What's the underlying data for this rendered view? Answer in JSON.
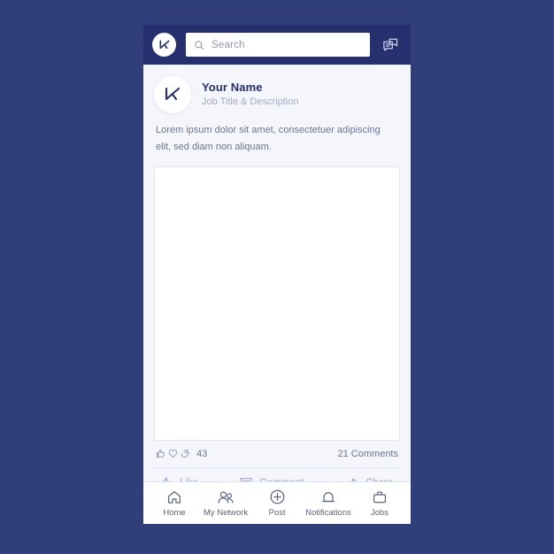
{
  "colors": {
    "page_background": "#303e79",
    "header_background": "#26306e",
    "card_background": "#f4f6fc",
    "brand_navy": "#26306e",
    "muted_text": "#6e7493",
    "placeholder_text": "#9296b4",
    "action_purple": "#9ea2d6",
    "subtitle_gray": "#a6aac6"
  },
  "header": {
    "logo_icon": "brand-logo-icon",
    "search": {
      "icon": "search-icon",
      "placeholder": "Search",
      "value": ""
    },
    "messages_icon": "messages-icon"
  },
  "post": {
    "avatar_icon": "brand-avatar-icon",
    "author_name": "Your Name",
    "author_title": "Job Title & Description",
    "body_text": "Lorem ipsum dolor sit amet, consectetuer adipiscing elit, sed diam non aliquam.",
    "image_placeholder_name": "post-image-placeholder",
    "stats": {
      "reaction_icons": [
        "thumbs-up-icon",
        "heart-icon",
        "clap-icon"
      ],
      "reaction_count": "43",
      "comments_text": "21 Comments"
    },
    "actions": [
      {
        "label": "Like",
        "icon": "thumbs-up-icon"
      },
      {
        "label": "Comment",
        "icon": "comment-icon"
      },
      {
        "label": "Share",
        "icon": "share-icon"
      }
    ]
  },
  "bottom_nav": {
    "items": [
      {
        "label": "Home",
        "icon": "home-icon"
      },
      {
        "label": "My Network",
        "icon": "people-icon"
      },
      {
        "label": "Post",
        "icon": "plus-circle-icon"
      },
      {
        "label": "Notifications",
        "icon": "bell-icon"
      },
      {
        "label": "Jobs",
        "icon": "briefcase-icon"
      }
    ]
  }
}
